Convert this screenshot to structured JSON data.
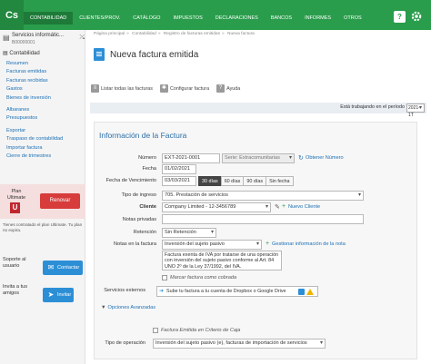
{
  "topbar": {
    "logo": "Cs",
    "nav": [
      "Contabilidad",
      "Clientes/Prov.",
      "Catálogo",
      "Impuestos",
      "Declaraciones",
      "Bancos",
      "Informes",
      "Otros"
    ],
    "help": "?"
  },
  "sidebar": {
    "company_name": "Servicios informátic...",
    "company_id": "B00000001",
    "section": "Contabilidad",
    "links": [
      "Resumen",
      "Facturas emitidas",
      "Facturas recibidas",
      "Gastos",
      "Bienes de inversión",
      "Albaranes",
      "Presupuestos",
      "Exportar",
      "Traspaso de contabilidad",
      "Importar factura",
      "Cierre de trimestres"
    ],
    "plan_label": "Plan Ultimate",
    "plan_icon": "U",
    "renew_button": "Renovar",
    "plan_note": "Tienes contratado el plan Ultimate. Tu plan no expira.",
    "support_text": "Soporte al usuario",
    "contact_button": "Contactar",
    "invite_text": "Invita a tus amigos",
    "invite_button": "Invitar"
  },
  "main": {
    "breadcrumb": [
      "Página principal",
      "Contabilidad",
      "Registro de facturas emitidas",
      "Nueva factura"
    ],
    "title": "Nueva factura emitida",
    "toolbar": [
      "Listar todas las facturas",
      "Configurar factura",
      "Ayuda"
    ],
    "period_label": "Está trabajando en el período",
    "period_value": "2021-1T"
  },
  "form": {
    "panel_title": "Información de la Factura",
    "numero_label": "Número",
    "numero_value": "EXT-2021-0001",
    "serie_value": "Serie: Extracomunitarias",
    "obtener_numero": "Obtener Número",
    "fecha_label": "Fecha",
    "fecha_value": "01/02/2021",
    "vencimiento_label": "Fecha de Vencimiento",
    "vencimiento_value": "03/03/2021",
    "vencimiento_options": [
      "30 días",
      "60 días",
      "90 días",
      "Sin fecha"
    ],
    "tipo_ingreso_label": "Tipo de ingreso",
    "tipo_ingreso_value": "705. Prestación de servicios",
    "cliente_label": "Cliente",
    "cliente_value": "Company Limited - 12-3456789",
    "nuevo_cliente": "Nuevo Cliente",
    "notas_privadas_label": "Notas privadas",
    "retencion_label": "Retención",
    "retencion_value": "Sin Retención",
    "notas_factura_label": "Notas en la factura",
    "notas_factura_value": "Inversión del sujeto pasivo",
    "gestionar_notas": "Gestionar información de la nota",
    "notas_text": "Factura exenta de IVA por tratarse de una operación con inversión del sujeto pasivo conforme al Art. 84 UNO 2º de la Ley 37/1992, del IVA.",
    "marcar_cobrada": "Marcar factura como cobrada",
    "servicios_label": "Servicios externos",
    "servicios_value": "Sube tu factura a tu cuenta de Dropbox o Google Drive",
    "opciones_avanzadas": "Opciones Avanzadas",
    "criterio_caja": "Factura Emitida en Criterio de Caja",
    "tipo_operacion_label": "Tipo de operación",
    "tipo_operacion_value": "Inversión del sujeto pasivo (e), facturas de importación de servicios"
  }
}
